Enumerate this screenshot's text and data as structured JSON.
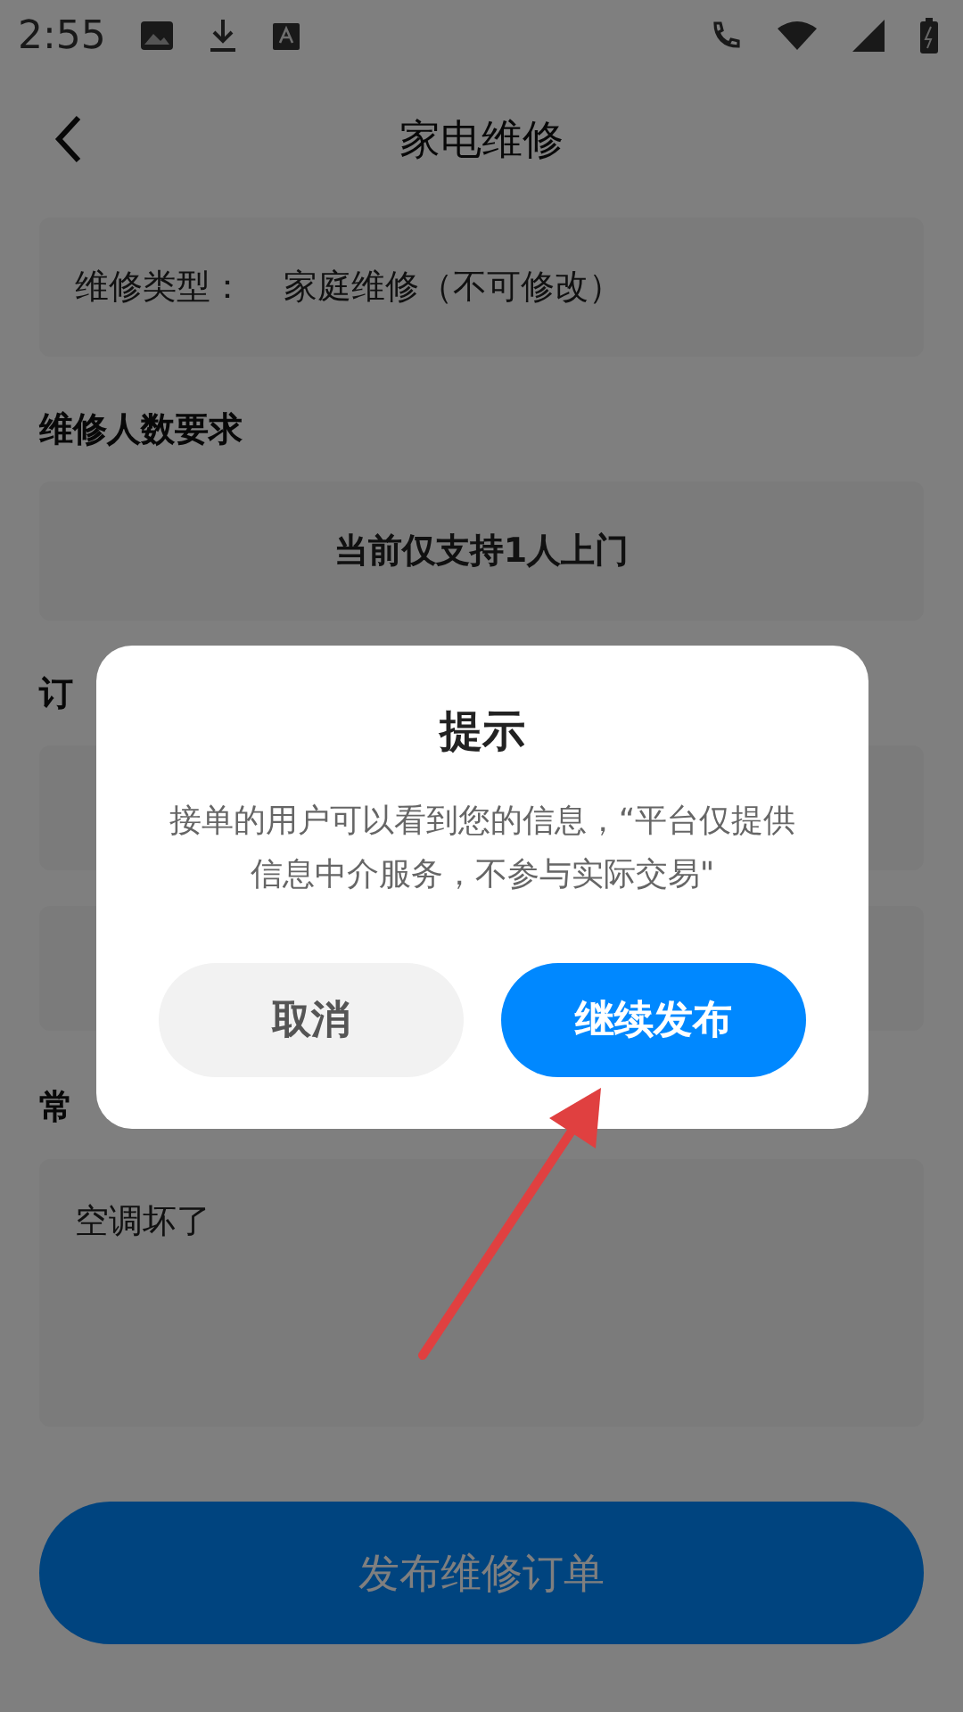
{
  "status_bar": {
    "time": "2:55"
  },
  "header": {
    "title": "家电维修"
  },
  "order_type": {
    "label": "维修类型：",
    "value": "家庭维修（不可修改）"
  },
  "headcount": {
    "heading": "维修人数要求",
    "note": "当前仅支持1人上门"
  },
  "contact": {
    "heading": "订"
  },
  "problem": {
    "heading": "常",
    "text": "空调坏了"
  },
  "submit": {
    "label": "发布维修订单"
  },
  "dialog": {
    "title": "提示",
    "message": "接单的用户可以看到您的信息，“平台仅提供信息中介服务，不参与实际交易\"",
    "buttons": [
      {
        "label": "取消",
        "kind": "cancel"
      },
      {
        "label": "继续发布",
        "kind": "primary"
      }
    ]
  }
}
